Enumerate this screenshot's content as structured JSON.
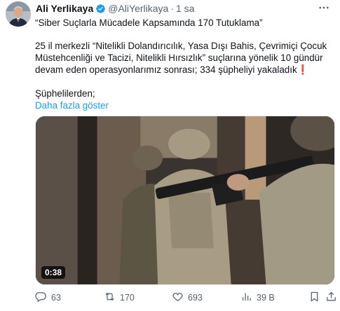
{
  "author": {
    "name": "Ali Yerlikaya",
    "handle": "@AliYerlikaya",
    "separator": "·",
    "time": "1 sa"
  },
  "tweet": {
    "title_line": "“Siber Suçlarla Mücadele Kapsamında 170 Tutuklama”",
    "body": "25 il merkezli “Nitelikli Dolandırıcılık, Yasa Dışı Bahis, Çevrimiçi Çocuk Müstehcenliği ve Tacizi, Nitelikli Hırsızlık” suçlarına yönelik 10 gündür devam eden operasyonlarımız sonrası; 334 şüpheliyi yakaladık❗",
    "suspects_label": "Şüphelilerden;",
    "show_more": "Daha fazla göster"
  },
  "media": {
    "duration": "0:38"
  },
  "actions": {
    "replies": "63",
    "reposts": "170",
    "likes": "693",
    "views": "39 B"
  },
  "icons": {
    "verified": "verified-badge-icon",
    "more": "more-options-icon",
    "reply": "reply-icon",
    "repost": "repost-icon",
    "like": "like-heart-icon",
    "views": "views-chart-icon",
    "bookmark": "bookmark-icon",
    "share": "share-icon"
  },
  "colors": {
    "link": "#1d9bf0",
    "secondary_text": "#536471",
    "primary_text": "#0f1419",
    "verified": "#1d9bf0"
  }
}
